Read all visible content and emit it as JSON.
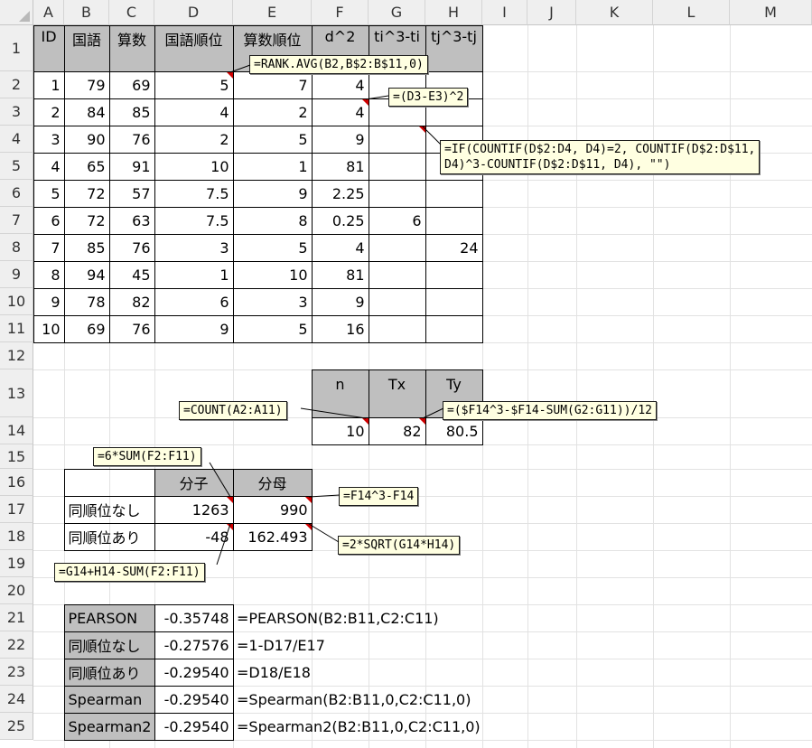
{
  "columns": [
    "A",
    "B",
    "C",
    "D",
    "E",
    "F",
    "G",
    "H",
    "I",
    "J",
    "K",
    "L",
    "M"
  ],
  "rows": [
    "1",
    "2",
    "3",
    "4",
    "5",
    "6",
    "7",
    "8",
    "9",
    "10",
    "11",
    "12",
    "13",
    "14",
    "15",
    "16",
    "17",
    "18",
    "19",
    "20",
    "21",
    "22",
    "23",
    "24",
    "25"
  ],
  "main_table": {
    "headers": [
      "ID",
      "国語",
      "算数",
      "国語順位",
      "算数順位",
      "d^2",
      "ti^3-ti",
      "tj^3-tj"
    ],
    "rows": [
      [
        "1",
        "79",
        "69",
        "5",
        "7",
        "4",
        "",
        ""
      ],
      [
        "2",
        "84",
        "85",
        "4",
        "2",
        "4",
        "",
        ""
      ],
      [
        "3",
        "90",
        "76",
        "2",
        "5",
        "9",
        "",
        ""
      ],
      [
        "4",
        "65",
        "91",
        "10",
        "1",
        "81",
        "",
        ""
      ],
      [
        "5",
        "72",
        "57",
        "7.5",
        "9",
        "2.25",
        "",
        ""
      ],
      [
        "6",
        "72",
        "63",
        "7.5",
        "8",
        "0.25",
        "6",
        ""
      ],
      [
        "7",
        "85",
        "76",
        "3",
        "5",
        "4",
        "",
        "24"
      ],
      [
        "8",
        "94",
        "45",
        "1",
        "10",
        "81",
        "",
        ""
      ],
      [
        "9",
        "78",
        "82",
        "6",
        "3",
        "9",
        "",
        ""
      ],
      [
        "10",
        "69",
        "76",
        "9",
        "5",
        "16",
        "",
        ""
      ]
    ]
  },
  "summary_table": {
    "headers": [
      "n",
      "Tx",
      "Ty"
    ],
    "values": [
      "10",
      "82",
      "80.5"
    ]
  },
  "fraction_table": {
    "headers": [
      "分子",
      "分母"
    ],
    "rows": [
      {
        "label": "同順位なし",
        "num": "1263",
        "den": "990"
      },
      {
        "label": "同順位あり",
        "num": "-48",
        "den": "162.493"
      }
    ]
  },
  "results": [
    {
      "label": "PEARSON",
      "value": "-0.35748",
      "formula": "=PEARSON(B2:B11,C2:C11)"
    },
    {
      "label": "同順位なし",
      "value": "-0.27576",
      "formula": "=1-D17/E17"
    },
    {
      "label": "同順位あり",
      "value": "-0.29540",
      "formula": "=D18/E18"
    },
    {
      "label": "Spearman",
      "value": "-0.29540",
      "formula": "=Spearman(B2:B11,0,C2:C11,0)"
    },
    {
      "label": "Spearman2",
      "value": "-0.29540",
      "formula": "=Spearman2(B2:B11,0,C2:C11,0)"
    }
  ],
  "notes": {
    "rank": "=RANK.AVG(B2,B$2:B$11,0)",
    "d2": "=(D3-E3)^2",
    "ties": "=IF(COUNTIF(D$2:D4, D4)=2, COUNTIF(D$2:D$11,\nD4)^3-COUNTIF(D$2:D$11, D4), \"\")",
    "count": "=COUNT(A2:A11)",
    "ty": "=($F14^3-$F14-SUM(G2:G11))/12",
    "num1": "=6*SUM(F2:F11)",
    "den1": "=F14^3-F14",
    "num2": "=G14+H14-SUM(F2:F11)",
    "den2": "=2*SQRT(G14*H14)"
  }
}
